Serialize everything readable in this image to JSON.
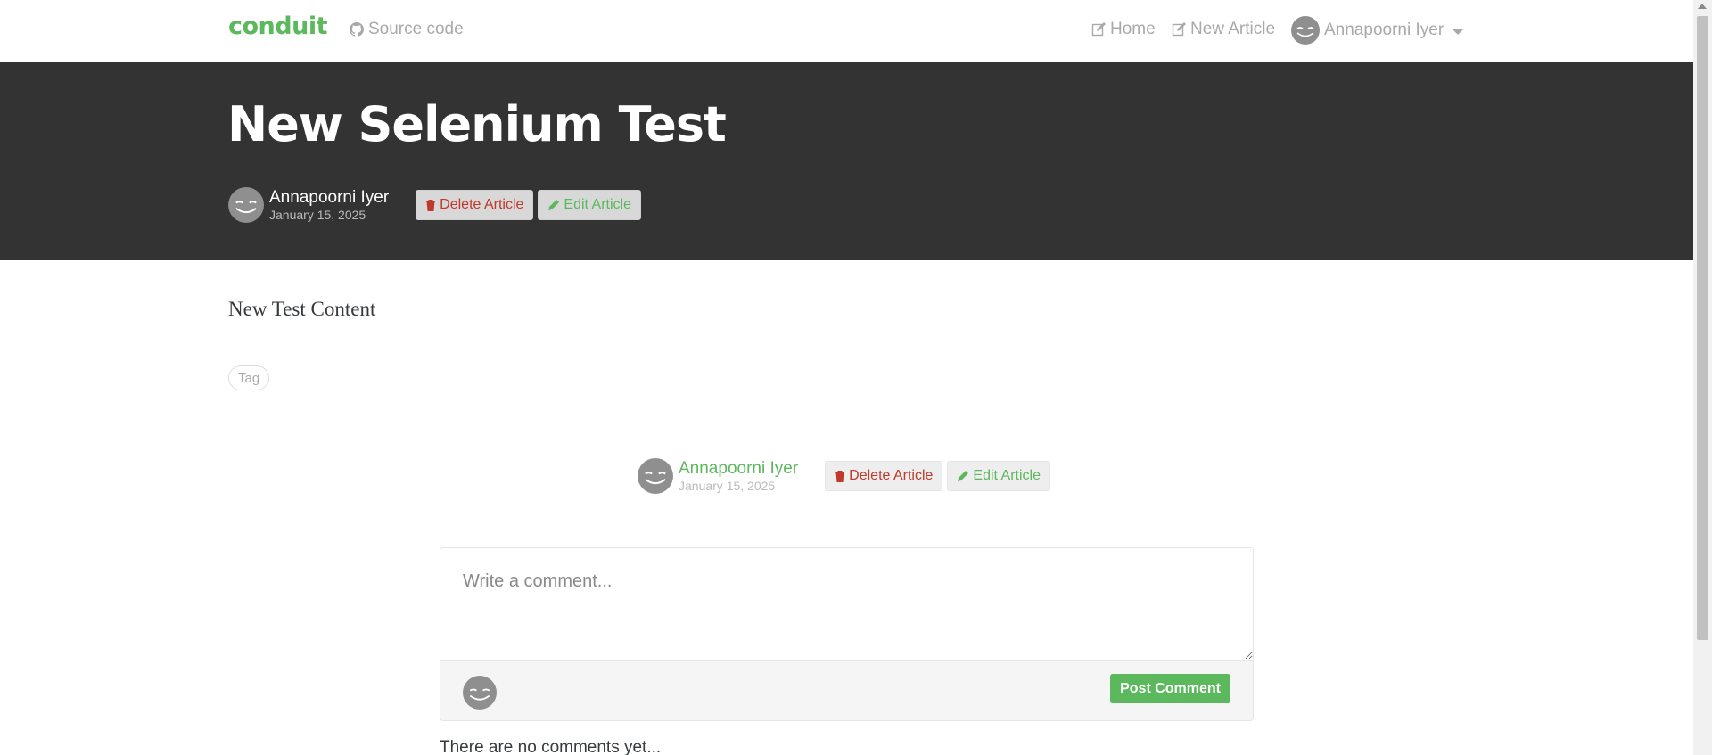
{
  "nav": {
    "brand": "conduit",
    "source_code": "Source code",
    "home": "Home",
    "new_article": "New Article",
    "user": "Annapoorni Iyer"
  },
  "article": {
    "title": "New Selenium Test",
    "author": "Annapoorni Iyer",
    "date": "January 15, 2025",
    "delete_label": "Delete Article",
    "edit_label": "Edit Article",
    "content": "New Test Content",
    "tags": [
      "Tag"
    ]
  },
  "comment_form": {
    "placeholder": "Write a comment...",
    "post_label": "Post Comment"
  },
  "comments": {
    "empty_text": "There are no comments yet..."
  },
  "colors": {
    "accent": "#5cb85c",
    "banner": "#333333",
    "danger": "#c0392b"
  },
  "icons": [
    "github-icon",
    "edit-icon",
    "pencil-icon",
    "trash-icon",
    "avatar-smiley-icon",
    "caret-down-icon"
  ]
}
